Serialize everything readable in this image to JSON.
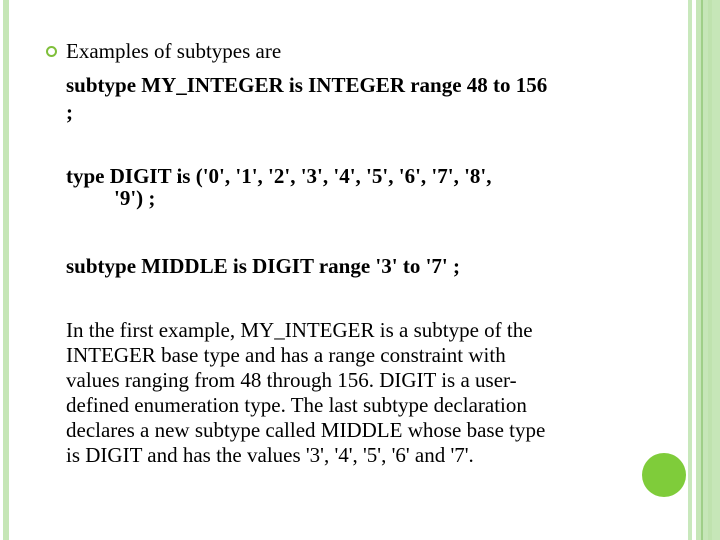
{
  "slide": {
    "intro": "Examples of subtypes are",
    "code1_line1": "subtype MY_INTEGER is INTEGER range 48 to 156",
    "code1_line2": ";",
    "code2_line1": "type DIGIT is ('0', '1', '2', '3', '4', '5', '6', '7', '8',",
    "code2_line2": "'9') ;",
    "code3": "subtype MIDDLE is DIGIT range '3' to '7' ;",
    "para": [
      "In the first example, MY_INTEGER is a subtype of the",
      "INTEGER base type and has a range constraint with",
      "values ranging from 48 through 156. DIGIT is a user-",
      "defined enumeration type. The last subtype declaration",
      "declares a new subtype called MIDDLE whose base type",
      "is DIGIT and has the values '3', '4', '5', '6' and '7'."
    ]
  },
  "colors": {
    "accent": "#7fcc3a",
    "stripe": "#c6e6b6"
  }
}
